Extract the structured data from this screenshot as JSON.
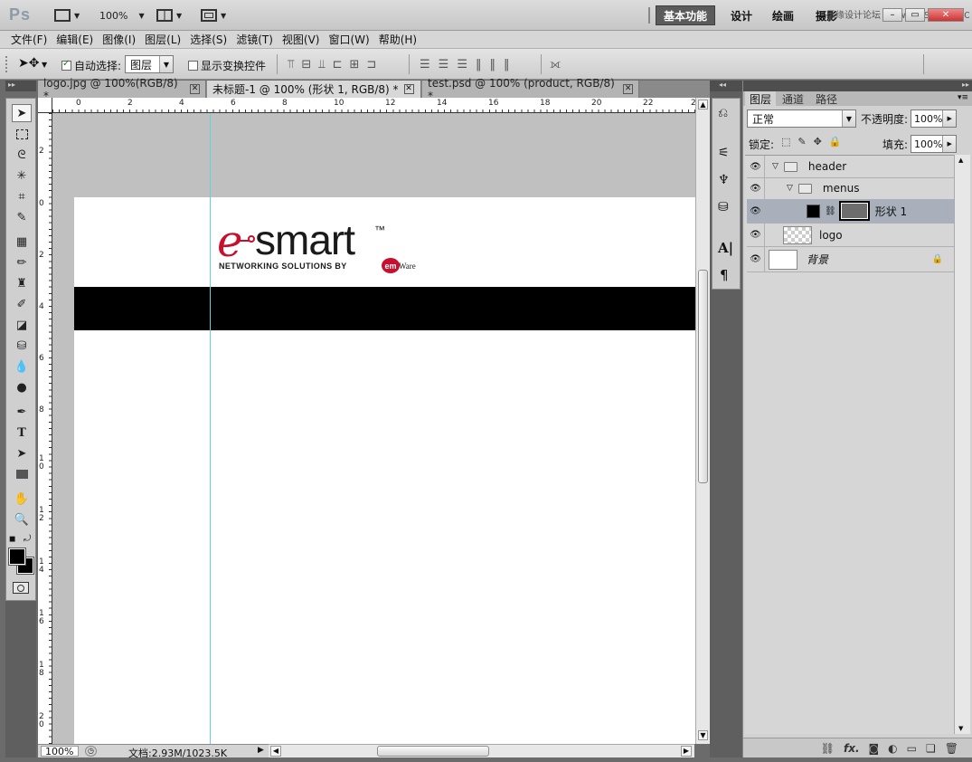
{
  "titlebar": {
    "app_logo": "Ps",
    "zoom": "100%",
    "workspaces": [
      "基本功能",
      "设计",
      "绘画",
      "摄影"
    ],
    "active_workspace": "基本功能",
    "watermark": "思缘设计论坛 www.MISSYUAN.COM"
  },
  "menubar": {
    "items": [
      "文件(F)",
      "编辑(E)",
      "图像(I)",
      "图层(L)",
      "选择(S)",
      "滤镜(T)",
      "视图(V)",
      "窗口(W)",
      "帮助(H)"
    ]
  },
  "options": {
    "auto_select_label": "自动选择:",
    "auto_select_checked": true,
    "auto_select_value": "图层",
    "show_transform_label": "显示变换控件",
    "show_transform_checked": false
  },
  "tabs": [
    {
      "label": "logo.jpg @ 100%(RGB/8) *",
      "active": false
    },
    {
      "label": "未标题-1 @ 100% (形状 1, RGB/8) *",
      "active": true
    },
    {
      "label": "test.psd @ 100% (product, RGB/8) *",
      "active": false
    }
  ],
  "ruler_top": [
    "0",
    "2",
    "4",
    "6",
    "8",
    "10",
    "12",
    "14",
    "16",
    "18",
    "20",
    "22",
    "2"
  ],
  "ruler_left": [
    "2",
    "0",
    "2",
    "4",
    "6",
    "8",
    "1\n0",
    "1\n2",
    "1\n4",
    "1\n6",
    "1\n8",
    "2\n0"
  ],
  "logo": {
    "e_letter": "e",
    "wordmark": "smart",
    "tm": "™",
    "tagline": "NETWORKING SOLUTIONS BY",
    "badge": "em",
    "badge_suffix": "Ware",
    "colors": {
      "red": "#c8102e",
      "dark": "#1a1a1a"
    }
  },
  "status": {
    "zoom": "100%",
    "doc_info": "文档:2.93M/1023.5K"
  },
  "layers_panel": {
    "tabs": [
      "图层",
      "通道",
      "路径"
    ],
    "active_tab": "图层",
    "blend_mode": "正常",
    "opacity_label": "不透明度:",
    "opacity_value": "100%",
    "lock_label": "锁定:",
    "fill_label": "填充:",
    "fill_value": "100%",
    "layers": [
      {
        "name": "header",
        "kind": "group",
        "depth": 0
      },
      {
        "name": "menus",
        "kind": "group",
        "depth": 1
      },
      {
        "name": "形状 1",
        "kind": "shape",
        "depth": 2,
        "selected": true
      },
      {
        "name": "logo",
        "kind": "pixel",
        "depth": 1
      },
      {
        "name": "背景",
        "kind": "background",
        "depth": 0,
        "locked": true
      }
    ],
    "footer_fx": "fx."
  }
}
